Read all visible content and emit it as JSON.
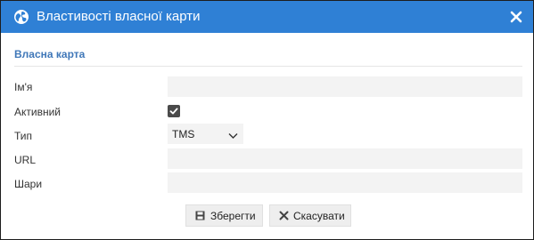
{
  "dialog": {
    "title": "Властивості власної карти",
    "title_icon": "globe-icon",
    "close_icon": "close-icon"
  },
  "section": {
    "title": "Власна карта"
  },
  "fields": {
    "name_label": "Ім'я",
    "name_value": "",
    "active_label": "Активний",
    "active_checked": true,
    "type_label": "Тип",
    "type_value": "TMS",
    "url_label": "URL",
    "url_value": "",
    "layers_label": "Шари",
    "layers_value": ""
  },
  "buttons": {
    "save_label": "Зберегти",
    "save_icon": "floppy-disk-icon",
    "cancel_label": "Скасувати",
    "cancel_icon": "x-icon"
  },
  "colors": {
    "titlebar": "#2f80d5",
    "section_title": "#3f77b8",
    "field_bg": "#f3f3f3"
  }
}
